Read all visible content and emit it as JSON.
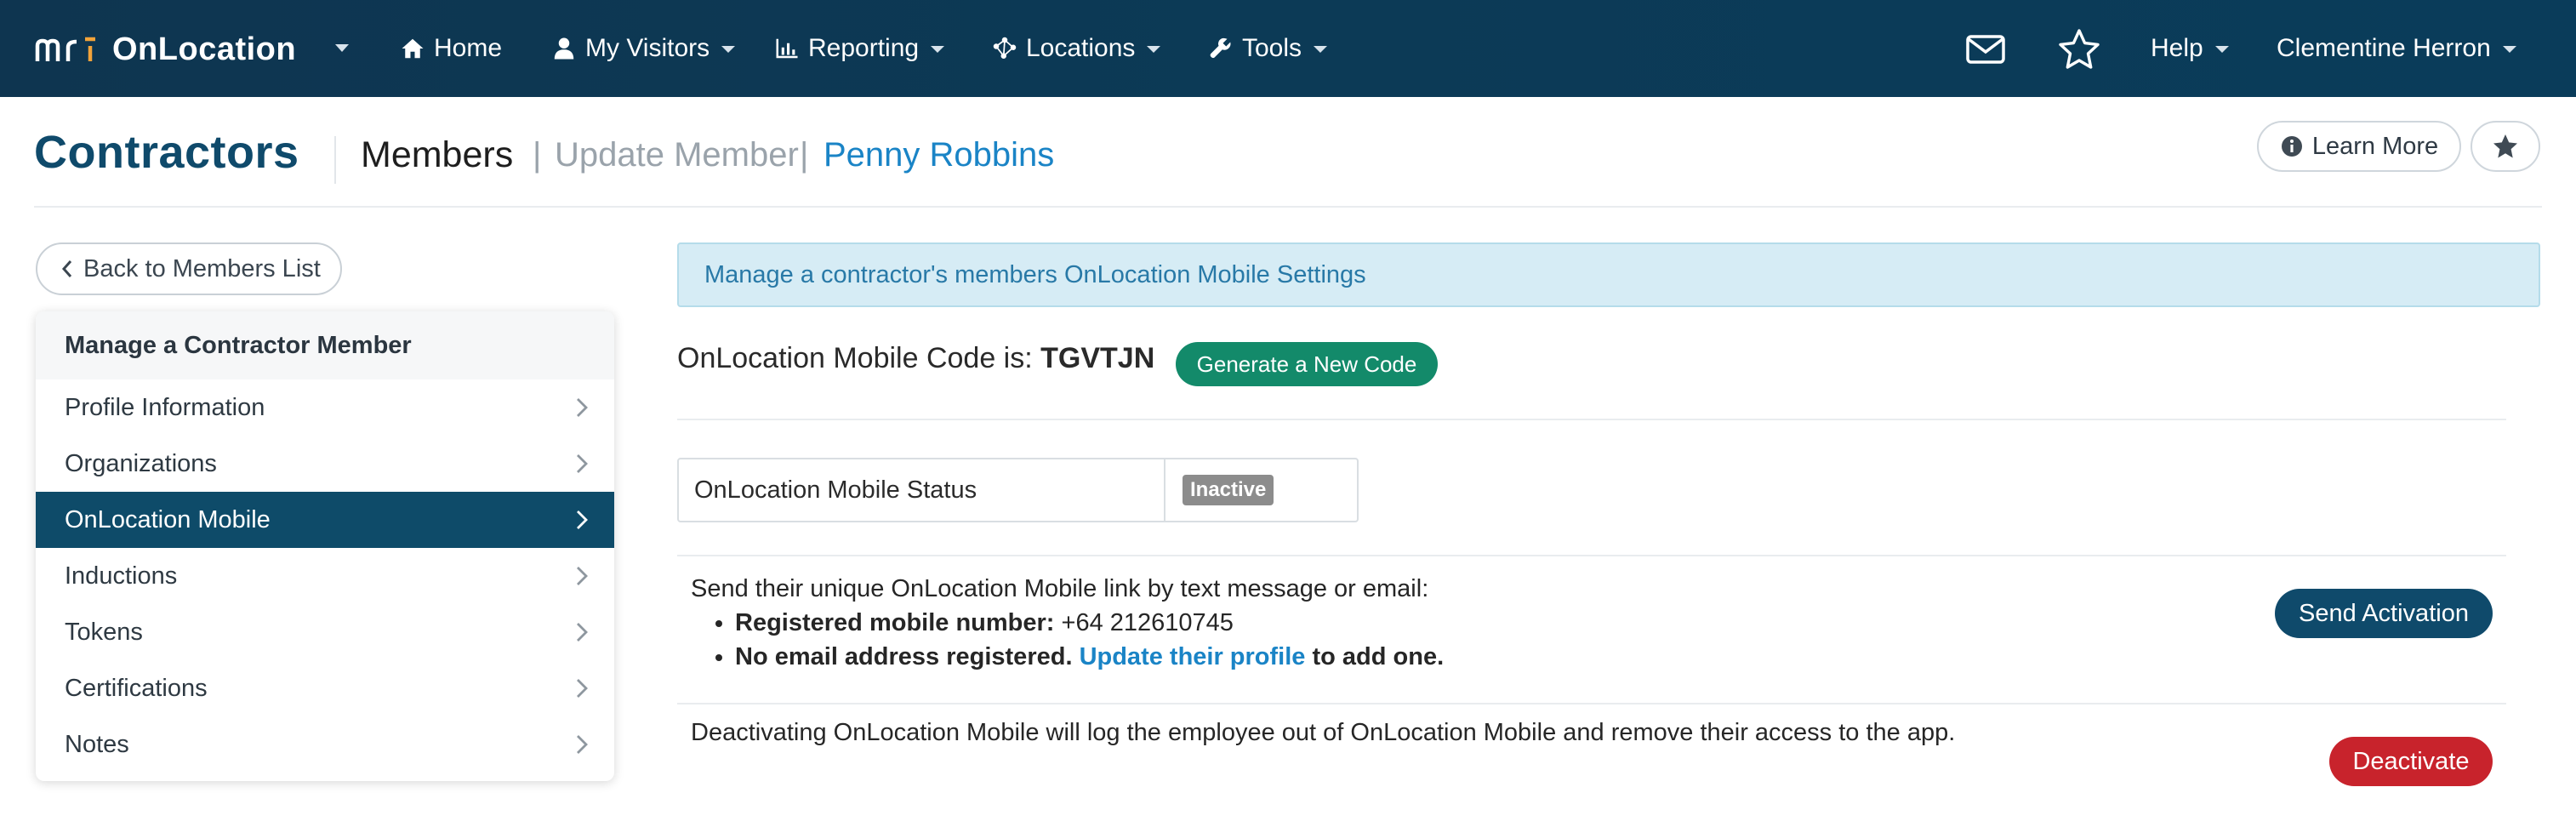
{
  "navbar": {
    "brand_mark": "mri",
    "brand_name": "OnLocation",
    "items": [
      {
        "label": "Home",
        "icon": "home-icon"
      },
      {
        "label": "My Visitors",
        "icon": "user-icon"
      },
      {
        "label": "Reporting",
        "icon": "bar-chart-icon"
      },
      {
        "label": "Locations",
        "icon": "network-icon"
      },
      {
        "label": "Tools",
        "icon": "wrench-icon"
      }
    ],
    "mail_icon": "envelope-icon",
    "favorites_icon": "star-icon",
    "help_label": "Help",
    "user_name": "Clementine Herron"
  },
  "header": {
    "title": "Contractors",
    "breadcrumb": {
      "section": "Members",
      "separator": "|",
      "page": "Update Member",
      "member": "Penny Robbins"
    },
    "learn_more_label": "Learn More"
  },
  "sidebar": {
    "back_label": "Back to Members List",
    "heading": "Manage a Contractor Member",
    "items": [
      {
        "label": "Profile Information",
        "active": false
      },
      {
        "label": "Organizations",
        "active": false
      },
      {
        "label": "OnLocation Mobile",
        "active": true
      },
      {
        "label": "Inductions",
        "active": false
      },
      {
        "label": "Tokens",
        "active": false
      },
      {
        "label": "Certifications",
        "active": false
      },
      {
        "label": "Notes",
        "active": false
      }
    ]
  },
  "main": {
    "info_message": "Manage a contractor's members OnLocation Mobile Settings",
    "code_prefix": "OnLocation Mobile Code is:",
    "code_value": "TGVTJN",
    "generate_label": "Generate a New Code",
    "status_label": "OnLocation Mobile Status",
    "status_value": "Inactive",
    "send_intro": "Send their unique OnLocation Mobile link by text message or email:",
    "mobile_label": "Registered mobile number:",
    "mobile_value": "+64 212610745",
    "no_email_text": "No email address registered.",
    "update_profile_link": "Update their profile",
    "add_one_text": "to add one.",
    "send_activation_label": "Send Activation",
    "deactivate_text": "Deactivating OnLocation Mobile will log the employee out of OnLocation Mobile and remove their access to the app.",
    "deactivate_label": "Deactivate"
  },
  "colors": {
    "navbar_bg": "#0e3550",
    "brand_blue": "#0f4a6b",
    "link_blue": "#1a84c6",
    "success_green": "#138a6a",
    "danger_red": "#c8232c",
    "info_bg": "#d6ecf5",
    "inactive_badge": "#8c8c8c"
  }
}
